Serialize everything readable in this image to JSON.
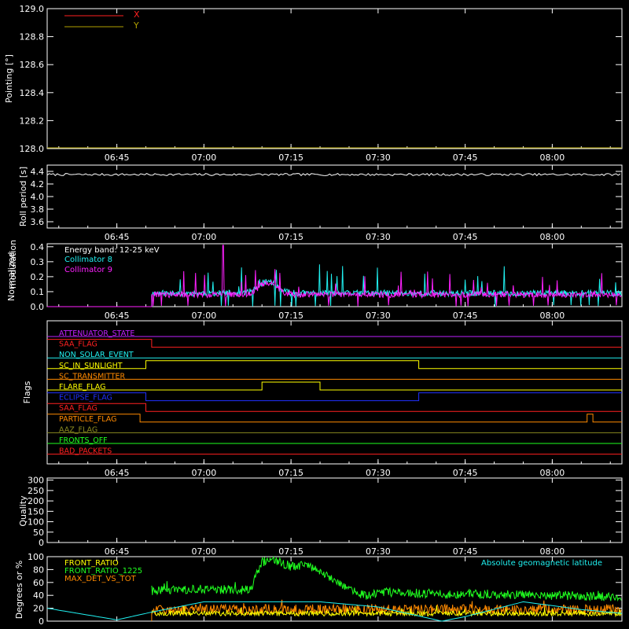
{
  "colors": {
    "background": "#000000",
    "foreground": "#ffffff",
    "red": "#ff2020",
    "yellow": "#ffff00",
    "olive": "#b0a000",
    "cyan": "#20f0f0",
    "magenta": "#ff20ff",
    "green": "#20ff20",
    "orange": "#ff8a00",
    "blue": "#2030ff",
    "purple": "#c020ff",
    "grey": "#8a8a20"
  },
  "time_ticks": [
    "06:45",
    "07:00",
    "07:15",
    "07:30",
    "07:45",
    "08:00"
  ],
  "time_tick_minutes": [
    45,
    60,
    75,
    90,
    105,
    120
  ],
  "time_range_minutes": [
    33,
    132
  ],
  "chart_data": [
    {
      "id": "pointing",
      "type": "line",
      "ylabel": "Pointing [°]",
      "ylim": [
        128.0,
        129.0
      ],
      "yticks": [
        "128.0",
        "128.2",
        "128.4",
        "128.6",
        "128.8",
        "129.0"
      ],
      "ytick_values": [
        128.0,
        128.2,
        128.4,
        128.6,
        128.8,
        129.0
      ],
      "series": [
        {
          "name": "X",
          "color": "#ff2020",
          "values": []
        },
        {
          "name": "Y",
          "color": "#b0a000",
          "values": []
        }
      ],
      "legend": "top-left"
    },
    {
      "id": "roll",
      "type": "line",
      "ylabel": "Roll period [s]",
      "ylim": [
        3.5,
        4.5
      ],
      "yticks": [
        "3.6",
        "3.8",
        "4.0",
        "4.2",
        "4.4"
      ],
      "ytick_values": [
        3.6,
        3.8,
        4.0,
        4.2,
        4.4
      ],
      "series": [
        {
          "name": "",
          "color": "#ffffff",
          "level": 4.35
        }
      ]
    },
    {
      "id": "modulation",
      "type": "line",
      "ylabel": "Normalized modulation",
      "ylim": [
        0.0,
        0.42
      ],
      "yticks": [
        "0.0",
        "0.1",
        "0.2",
        "0.3",
        "0.4"
      ],
      "ytick_values": [
        0.0,
        0.1,
        0.2,
        0.3,
        0.4
      ],
      "legend_title": "Energy band: 12-25 keV",
      "data_start_minute": 51,
      "series": [
        {
          "name": "Collimator 8",
          "color": "#20f0f0",
          "baseline": 0.09
        },
        {
          "name": "Collimator 9",
          "color": "#ff20ff",
          "baseline": 0.08
        }
      ],
      "annotations": [
        {
          "x_minute": 71,
          "y": 0.17,
          "note": "bump"
        }
      ]
    },
    {
      "id": "flags",
      "type": "line",
      "ylabel": "Flags",
      "flags": [
        {
          "label": "ATTENUATOR_STATE",
          "color": "#c020ff",
          "steps": []
        },
        {
          "label": "SAA_FLAG",
          "color": "#ff2020",
          "steps": [
            [
              33,
              1
            ],
            [
              51,
              0
            ]
          ]
        },
        {
          "label": "NON_SOLAR_EVENT",
          "color": "#20f0f0",
          "steps": []
        },
        {
          "label": "SC_IN_SUNLIGHT",
          "color": "#ffff00",
          "steps": [
            [
              33,
              0
            ],
            [
              50,
              1
            ],
            [
              97,
              0
            ]
          ]
        },
        {
          "label": "SC_TRANSMITTER",
          "color": "#ff8a00",
          "steps": []
        },
        {
          "label": "FLARE_FLAG",
          "color": "#ffff00",
          "steps": [
            [
              33,
              0
            ],
            [
              70,
              1
            ],
            [
              80,
              0
            ]
          ]
        },
        {
          "label": "ECLIPSE_FLAG",
          "color": "#2030ff",
          "steps": [
            [
              33,
              1
            ],
            [
              50,
              0
            ],
            [
              97,
              1
            ]
          ]
        },
        {
          "label": "SAA_FLAG",
          "color": "#ff2020",
          "steps": [
            [
              33,
              1
            ],
            [
              50,
              0
            ]
          ]
        },
        {
          "label": "PARTICLE_FLAG",
          "color": "#ff8a00",
          "steps": [
            [
              33,
              1
            ],
            [
              49,
              0
            ],
            [
              126,
              1
            ],
            [
              127,
              0
            ]
          ]
        },
        {
          "label": "AAZ_FLAG",
          "color": "#8a8a20",
          "steps": []
        },
        {
          "label": "FRONTS_OFF",
          "color": "#20ff20",
          "steps": []
        },
        {
          "label": "BAD_PACKETS",
          "color": "#ff2020",
          "steps": []
        }
      ]
    },
    {
      "id": "quality",
      "type": "line",
      "ylabel": "Quality",
      "ylim": [
        0,
        310
      ],
      "yticks": [
        "0",
        "50",
        "100",
        "150",
        "200",
        "250",
        "300"
      ],
      "ytick_values": [
        0,
        50,
        100,
        150,
        200,
        250,
        300
      ],
      "series": []
    },
    {
      "id": "ratios",
      "type": "line",
      "ylabel": "Degrees or %",
      "ylim": [
        0,
        100
      ],
      "yticks": [
        "0",
        "20",
        "40",
        "60",
        "80",
        "100"
      ],
      "ytick_values": [
        0,
        20,
        40,
        60,
        80,
        100
      ],
      "data_start_minute": 51,
      "series": [
        {
          "name": "FRONT_RATIO",
          "color": "#ffff00",
          "baseline": 12
        },
        {
          "name": "FRONT_RATIO_1225",
          "color": "#20ff20",
          "baseline": 45,
          "x": [
            51,
            60,
            68,
            70,
            72,
            75,
            78,
            80,
            83,
            86,
            88,
            92,
            100,
            110,
            120,
            132
          ],
          "y": [
            47,
            50,
            48,
            92,
            95,
            85,
            88,
            75,
            62,
            45,
            40,
            45,
            42,
            42,
            40,
            38
          ]
        },
        {
          "name": "MAX_DET_VS_TOT",
          "color": "#ff8a00",
          "baseline": 18
        },
        {
          "name": "Absolute geomagnetic latitude",
          "color": "#20f0f0",
          "x": [
            33,
            45,
            51,
            60,
            80,
            90,
            95,
            101,
            105,
            115,
            125,
            132
          ],
          "y": [
            20,
            2,
            14,
            30,
            30,
            22,
            12,
            0,
            7,
            30,
            18,
            12
          ]
        }
      ]
    }
  ]
}
